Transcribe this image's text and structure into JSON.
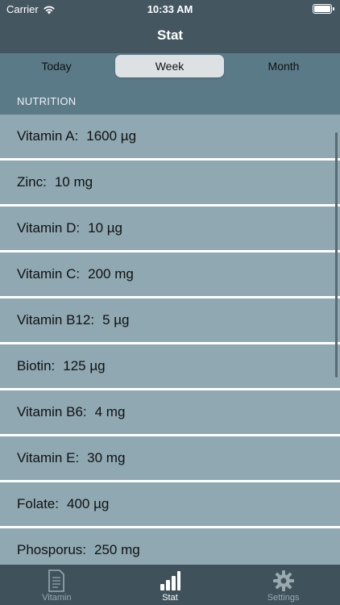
{
  "status": {
    "carrier": "Carrier",
    "time": "10:33 AM"
  },
  "nav": {
    "title": "Stat"
  },
  "segments": {
    "items": [
      "Today",
      "Week",
      "Month"
    ],
    "selected": "Week"
  },
  "section": {
    "header": "NUTRITION"
  },
  "nutrition": [
    {
      "name": "Vitamin A:",
      "value": "1600 µg"
    },
    {
      "name": "Zinc:",
      "value": "10 mg"
    },
    {
      "name": "Vitamin D:",
      "value": "10 µg"
    },
    {
      "name": "Vitamin C:",
      "value": "200 mg"
    },
    {
      "name": "Vitamin B12:",
      "value": "5 µg"
    },
    {
      "name": "Biotin:",
      "value": "125 µg"
    },
    {
      "name": "Vitamin B6:",
      "value": "4 mg"
    },
    {
      "name": "Vitamin E:",
      "value": "30 mg"
    },
    {
      "name": "Folate:",
      "value": "400 µg"
    },
    {
      "name": "Phosporus:",
      "value": "250 mg"
    }
  ],
  "tabbar": {
    "items": [
      {
        "label": "Vitamin",
        "icon": "document-icon"
      },
      {
        "label": "Stat",
        "icon": "bar-chart-icon"
      },
      {
        "label": "Settings",
        "icon": "gear-icon"
      }
    ],
    "active": "Stat"
  },
  "colors": {
    "navbar": "#445761",
    "segment_bg": "#5a7a88",
    "row_bg": "#8fa8b1",
    "tabbar": "#3f525c",
    "tab_active": "#ffffff",
    "tab_inactive": "#9aa9b0"
  }
}
